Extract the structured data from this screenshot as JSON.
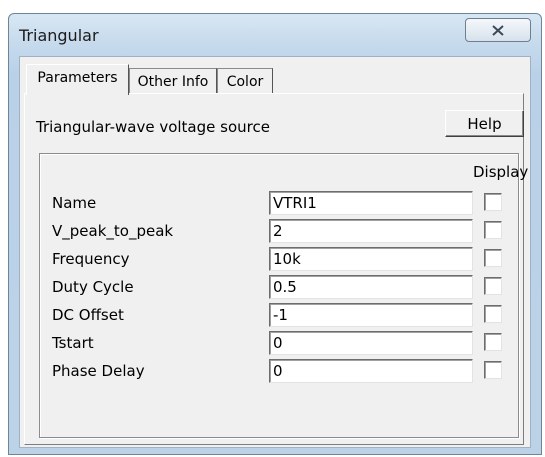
{
  "window": {
    "title": "Triangular",
    "close_icon": "close-icon"
  },
  "tabs": [
    {
      "label": "Parameters",
      "active": true
    },
    {
      "label": "Other Info",
      "active": false
    },
    {
      "label": "Color",
      "active": false
    }
  ],
  "description": "Triangular-wave voltage source",
  "help_label": "Help",
  "display_header": "Display",
  "params": [
    {
      "label": "Name",
      "value": "VTRI1",
      "display": false
    },
    {
      "label": "V_peak_to_peak",
      "value": "2",
      "display": false
    },
    {
      "label": "Frequency",
      "value": "10k",
      "display": false
    },
    {
      "label": "Duty Cycle",
      "value": "0.5",
      "display": false
    },
    {
      "label": "DC Offset",
      "value": "-1",
      "display": false
    },
    {
      "label": "Tstart",
      "value": "0",
      "display": false
    },
    {
      "label": "Phase Delay",
      "value": "0",
      "display": false
    }
  ]
}
